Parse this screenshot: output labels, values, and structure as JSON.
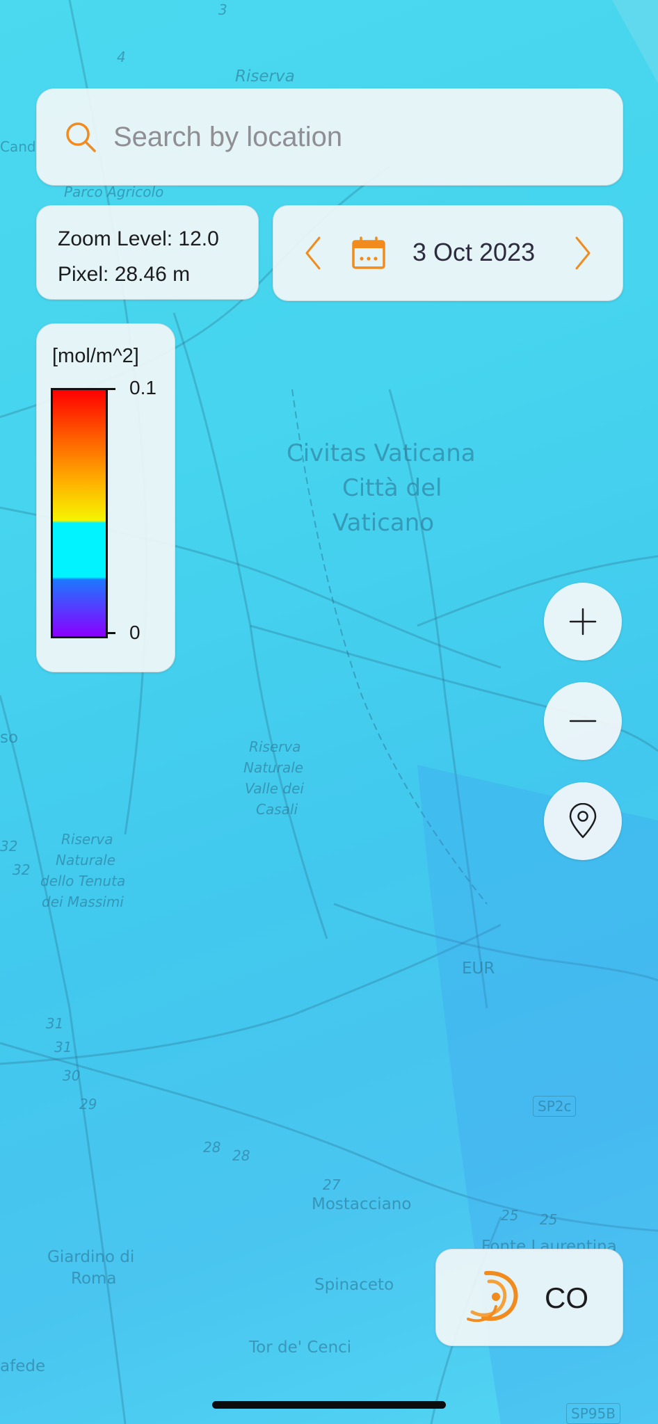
{
  "search": {
    "placeholder": "Search by location"
  },
  "zoom_info": {
    "zoom_level": "Zoom Level: 12.0",
    "pixel": "Pixel: 28.46 m"
  },
  "date_bar": {
    "date": "3 Oct 2023"
  },
  "legend": {
    "unit": "[mol/m^2]",
    "max_label": "0.1",
    "min_label": "0",
    "colors": [
      "#ff0000",
      "#ff6a00",
      "#ffb400",
      "#f5f500",
      "#00f3ff",
      "#1e78ff",
      "#8a00ff"
    ]
  },
  "product": {
    "label": "CO"
  },
  "map_labels": {
    "riserva_top": "Riserva",
    "candido": "Cand",
    "parco": "Parco Agricolo",
    "vatican_1": "Civitas Vaticana",
    "vatican_2": "Città del",
    "vatican_3": "Vaticano",
    "valle_1": "Riserva",
    "valle_2": "Naturale",
    "valle_3": "Valle dei",
    "valle_4": "Casali",
    "tenuta_1": "Riserva",
    "tenuta_2": "Naturale",
    "tenuta_3": "dello Tenuta",
    "tenuta_4": "dei Massimi",
    "eur": "EUR",
    "sp2c": "SP2c",
    "mostacciano": "Mostacciano",
    "fonte": "Fonte Laurentina",
    "giardino_1": "Giardino di",
    "giardino_2": "Roma",
    "spinaceto": "Spinaceto",
    "tor": "Tor de' Cenci",
    "afede": "afede",
    "sp95b": "SP95B",
    "so": "so",
    "r4": "4",
    "r3": "3",
    "r32a": "32",
    "r32b": "32",
    "r31a": "31",
    "r31b": "31",
    "r30": "30",
    "r29": "29",
    "r28a": "28",
    "r28b": "28",
    "r27": "27",
    "r25a": "25",
    "r25b": "25"
  },
  "colors": {
    "accent": "#f28b1d",
    "map_tint": "#45d3ee"
  }
}
